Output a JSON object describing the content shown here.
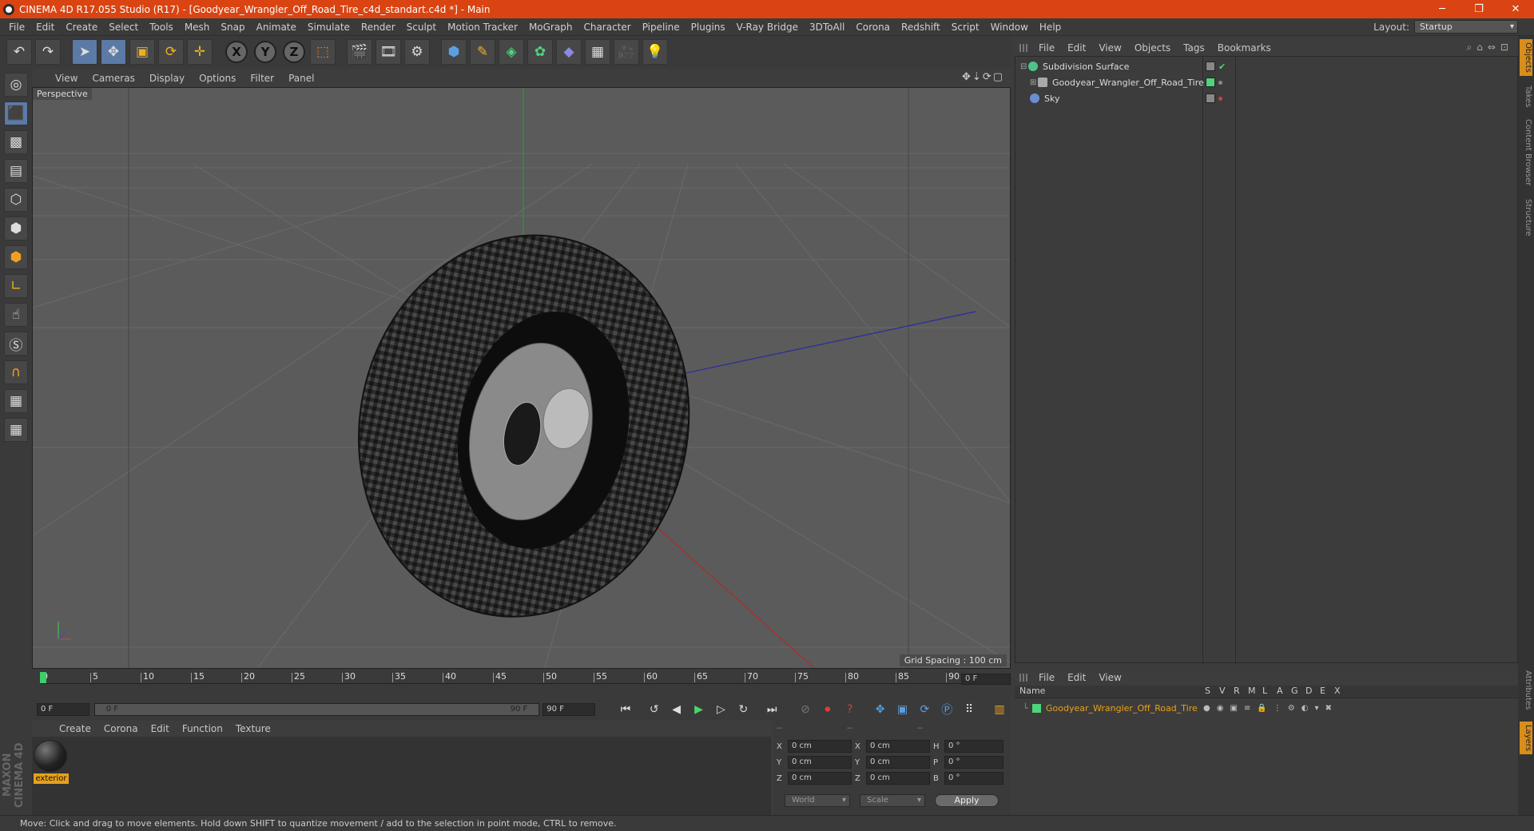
{
  "title": "CINEMA 4D R17.055 Studio (R17) - [Goodyear_Wrangler_Off_Road_Tire_c4d_standart.c4d *] - Main",
  "menus": [
    "File",
    "Edit",
    "Create",
    "Select",
    "Tools",
    "Mesh",
    "Snap",
    "Animate",
    "Simulate",
    "Render",
    "Sculpt",
    "Motion Tracker",
    "MoGraph",
    "Character",
    "Pipeline",
    "Plugins",
    "V-Ray Bridge",
    "3DToAll",
    "Corona",
    "Redshift",
    "Script",
    "Window",
    "Help"
  ],
  "layout": {
    "label": "Layout:",
    "value": "Startup"
  },
  "viewport": {
    "menus": [
      "View",
      "Cameras",
      "Display",
      "Options",
      "Filter",
      "Panel"
    ],
    "label": "Perspective",
    "grid_spacing": "Grid Spacing : 100 cm"
  },
  "timeline": {
    "ticks": [
      "0",
      "5",
      "10",
      "15",
      "20",
      "25",
      "30",
      "35",
      "40",
      "45",
      "50",
      "55",
      "60",
      "65",
      "70",
      "75",
      "80",
      "85",
      "90"
    ],
    "current_frame": "0 F",
    "start": "0 F",
    "slider_start": "0 F",
    "slider_end": "90 F",
    "end": "90 F"
  },
  "materials": {
    "menus": [
      "Create",
      "Corona",
      "Edit",
      "Function",
      "Texture"
    ],
    "items": [
      {
        "name": "exterior"
      }
    ]
  },
  "coords": {
    "headers": [
      "--",
      "--",
      "--"
    ],
    "rows": [
      {
        "a": "X",
        "av": "0 cm",
        "b": "X",
        "bv": "0 cm",
        "c": "H",
        "cv": "0 °"
      },
      {
        "a": "Y",
        "av": "0 cm",
        "b": "Y",
        "bv": "0 cm",
        "c": "P",
        "cv": "0 °"
      },
      {
        "a": "Z",
        "av": "0 cm",
        "b": "Z",
        "bv": "0 cm",
        "c": "B",
        "cv": "0 °"
      }
    ],
    "world": "World",
    "scale": "Scale",
    "apply": "Apply"
  },
  "objects": {
    "menus": [
      "File",
      "Edit",
      "View",
      "Objects",
      "Tags",
      "Bookmarks"
    ],
    "items": [
      {
        "name": "Subdivision Surface",
        "color": "#4fc48a"
      },
      {
        "name": "Goodyear_Wrangler_Off_Road_Tire",
        "color": "#aaaaaa"
      },
      {
        "name": "Sky",
        "color": "#6a8fd0"
      }
    ]
  },
  "layers": {
    "menus": [
      "File",
      "Edit",
      "View"
    ],
    "columns": [
      "Name",
      "S",
      "V",
      "R",
      "M",
      "L",
      "A",
      "G",
      "D",
      "E",
      "X"
    ],
    "items": [
      {
        "name": "Goodyear_Wrangler_Off_Road_Tire",
        "color": "#4fd47a"
      }
    ]
  },
  "side_tabs": [
    "Objects",
    "Takes",
    "Content Browser",
    "Structure",
    "Attributes",
    "Layers"
  ],
  "status": "Move: Click and drag to move elements. Hold down SHIFT to quantize movement / add to the selection in point mode, CTRL to remove.",
  "brand": "MAXON CINEMA 4D"
}
